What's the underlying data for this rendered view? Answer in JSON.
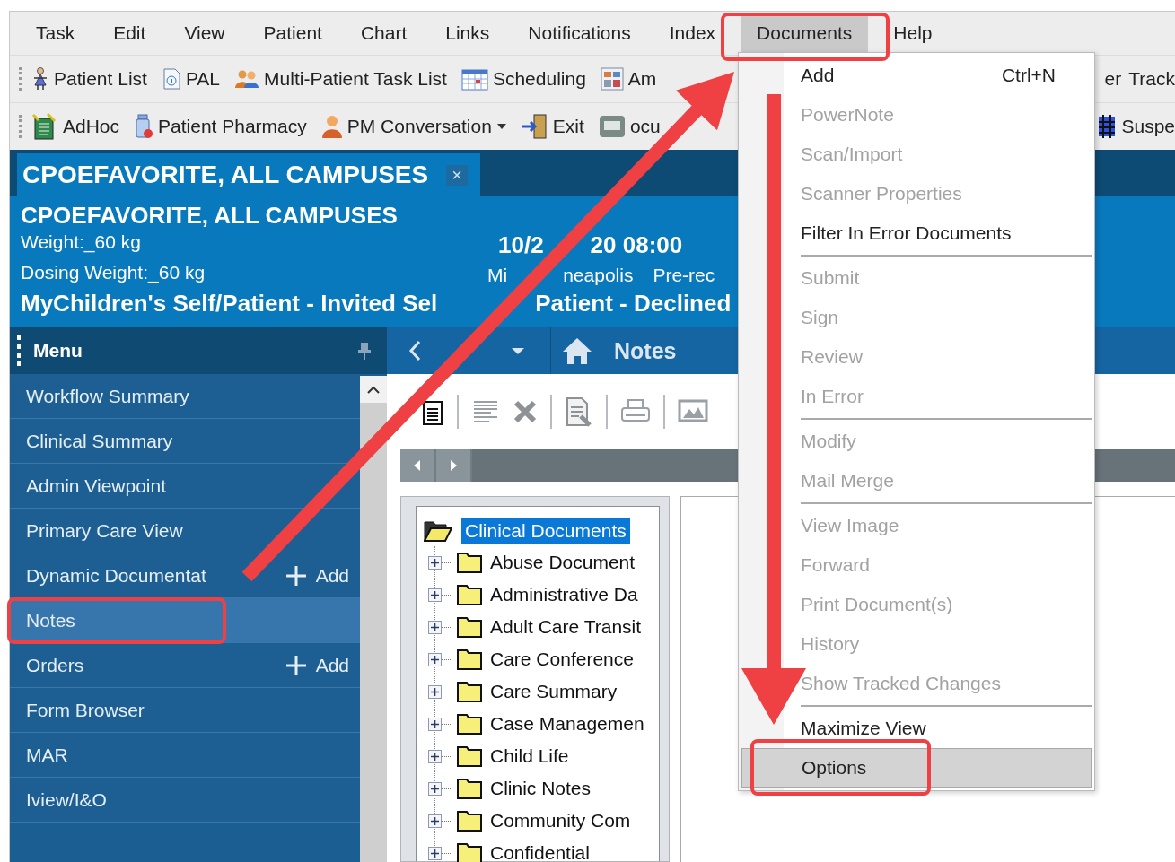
{
  "menu_bar": [
    {
      "label": "Task",
      "selected": false
    },
    {
      "label": "Edit",
      "selected": false
    },
    {
      "label": "View",
      "selected": false
    },
    {
      "label": "Patient",
      "selected": false
    },
    {
      "label": "Chart",
      "selected": false
    },
    {
      "label": "Links",
      "selected": false
    },
    {
      "label": "Notifications",
      "selected": false
    },
    {
      "label": "Index",
      "selected": false
    },
    {
      "label": "Documents",
      "selected": true
    },
    {
      "label": "Help",
      "selected": false
    }
  ],
  "toolbar_1": {
    "items": [
      {
        "label": "Patient List",
        "dropdown": false
      },
      {
        "label": "PAL",
        "dropdown": false
      },
      {
        "label": "Multi-Patient Task List",
        "dropdown": false
      },
      {
        "label": "Scheduling",
        "dropdown": false
      },
      {
        "label": "Am",
        "dropdown": false
      }
    ],
    "right_items": [
      "er",
      "Track"
    ]
  },
  "toolbar_2": {
    "items": [
      {
        "label": "AdHoc",
        "dropdown": false
      },
      {
        "label": "Patient Pharmacy",
        "dropdown": false
      },
      {
        "label": "PM Conversation",
        "dropdown": true
      },
      {
        "label": "Exit",
        "dropdown": false
      },
      {
        "label": "ocu",
        "dropdown": false
      }
    ],
    "right_items": [
      "Suspe"
    ]
  },
  "patient_tab": {
    "label": "CPOEFAVORITE, ALL CAMPUSES",
    "close": "×",
    "selected": true
  },
  "banner": {
    "name": "CPOEFAVORITE, ALL CAMPUSES",
    "weight": "Weight:_60 kg",
    "dosing_weight": "Dosing Weight:_60 kg",
    "date_parts": [
      "10/2",
      "20 08:00"
    ],
    "location_parts": [
      "Mi",
      "neapolis"
    ],
    "status": "Pre-rec",
    "portal_parts": [
      "MyChildren's Self/Patient - Invited Sel",
      "Patient - Declined"
    ]
  },
  "side_menu": {
    "title": "Menu",
    "items": [
      {
        "label": "Workflow Summary",
        "selected": false
      },
      {
        "label": "Clinical Summary",
        "selected": false
      },
      {
        "label": "Admin Viewpoint",
        "selected": false
      },
      {
        "label": "Primary Care View",
        "selected": false
      },
      {
        "label": "Dynamic Documentat",
        "selected": false,
        "add_label": "Add"
      },
      {
        "label": "Notes",
        "selected": true
      },
      {
        "label": "Orders",
        "selected": false,
        "add_label": "Add"
      },
      {
        "label": "Form Browser",
        "selected": false
      },
      {
        "label": "MAR",
        "selected": false
      },
      {
        "label": "Iview/I&O",
        "selected": false
      }
    ]
  },
  "view": {
    "title": "Notes"
  },
  "tree": {
    "label": "Clinical Documents",
    "selected": true,
    "expanded": true,
    "children": [
      {
        "label": "Abuse Document",
        "selected": false,
        "expanded": false
      },
      {
        "label": "Administrative Da",
        "selected": false,
        "expanded": false
      },
      {
        "label": "Adult Care Transit",
        "selected": false,
        "expanded": false
      },
      {
        "label": "Care Conference",
        "selected": false,
        "expanded": false
      },
      {
        "label": "Care Summary",
        "selected": false,
        "expanded": false
      },
      {
        "label": "Case Managemen",
        "selected": false,
        "expanded": false
      },
      {
        "label": "Child Life",
        "selected": false,
        "expanded": false
      },
      {
        "label": "Clinic Notes",
        "selected": false,
        "expanded": false
      },
      {
        "label": "Community Com",
        "selected": false,
        "expanded": false
      },
      {
        "label": "Confidential",
        "selected": false,
        "expanded": false
      }
    ]
  },
  "documents_menu": {
    "groups": [
      [
        {
          "label": "Add",
          "shortcut": "Ctrl+N",
          "disabled": false,
          "selected": false
        },
        {
          "label": "PowerNote",
          "disabled": true,
          "selected": false
        },
        {
          "label": "Scan/Import",
          "disabled": true,
          "selected": false
        },
        {
          "label": "Scanner Properties",
          "disabled": true,
          "selected": false
        },
        {
          "label": "Filter In Error Documents",
          "disabled": false,
          "selected": false
        }
      ],
      [
        {
          "label": "Submit",
          "disabled": true,
          "selected": false
        },
        {
          "label": "Sign",
          "disabled": true,
          "selected": false
        },
        {
          "label": "Review",
          "disabled": true,
          "selected": false
        },
        {
          "label": "In Error",
          "disabled": true,
          "selected": false
        }
      ],
      [
        {
          "label": "Modify",
          "disabled": true,
          "selected": false
        },
        {
          "label": "Mail Merge",
          "disabled": true,
          "selected": false
        }
      ],
      [
        {
          "label": "View Image",
          "disabled": true,
          "selected": false
        },
        {
          "label": "Forward",
          "disabled": true,
          "selected": false
        },
        {
          "label": "Print Document(s)",
          "disabled": true,
          "selected": false
        },
        {
          "label": "History",
          "disabled": true,
          "selected": false
        },
        {
          "label": "Show Tracked Changes",
          "disabled": true,
          "selected": false
        }
      ],
      [
        {
          "label": "Maximize View",
          "disabled": false,
          "selected": false
        },
        {
          "label": "Options",
          "disabled": false,
          "selected": true
        }
      ]
    ]
  }
}
